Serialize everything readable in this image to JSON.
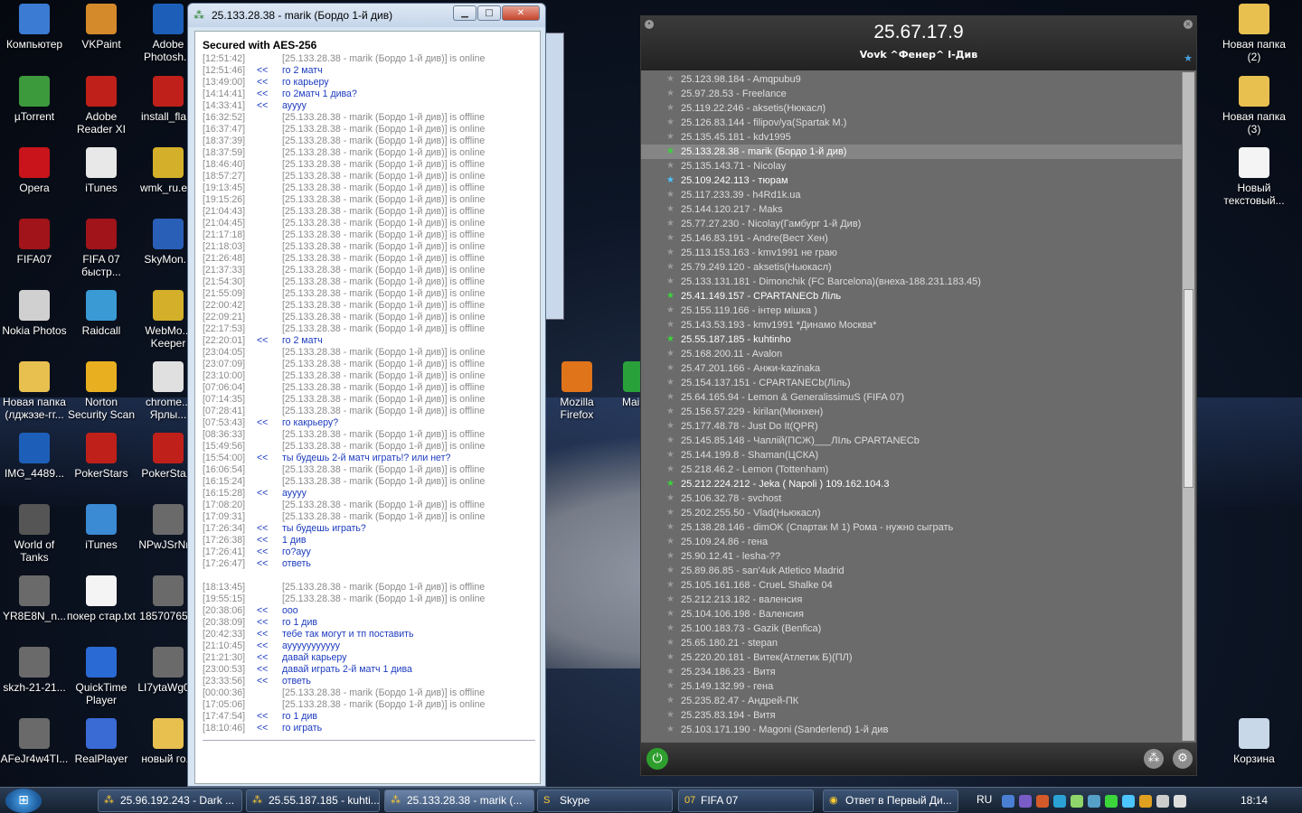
{
  "desktop_icons": [
    {
      "label": "Компьютер",
      "icon": "computer-icon"
    },
    {
      "label": "VKPaint",
      "icon": "paint-icon"
    },
    {
      "label": "Adobe Photosh...",
      "icon": "photoshop-icon"
    },
    {
      "label": "µTorrent",
      "icon": "utorrent-icon"
    },
    {
      "label": "Adobe Reader XI",
      "icon": "acrobat-icon"
    },
    {
      "label": "install_fla...",
      "icon": "flash-icon"
    },
    {
      "label": "Opera",
      "icon": "opera-icon"
    },
    {
      "label": "iTunes",
      "icon": "itunes-doc-icon"
    },
    {
      "label": "wmk_ru.e...",
      "icon": "webmoney-icon"
    },
    {
      "label": "FIFA07",
      "icon": "fifa-icon"
    },
    {
      "label": "FIFA 07 быстр...",
      "icon": "fifa-icon"
    },
    {
      "label": "SkyMon...",
      "icon": "skymon-icon"
    },
    {
      "label": "Nokia Photos",
      "icon": "nokia-icon"
    },
    {
      "label": "Raidcall",
      "icon": "raidcall-icon"
    },
    {
      "label": "WebMo... Keeper",
      "icon": "webmoney-icon"
    },
    {
      "label": "Новая папка (лджэзе-гг...",
      "icon": "folder-icon"
    },
    {
      "label": "Norton Security Scan",
      "icon": "norton-icon"
    },
    {
      "label": "chrome... Ярлы...",
      "icon": "chrome-icon"
    },
    {
      "label": "IMG_4489...",
      "icon": "psd-icon"
    },
    {
      "label": "PokerStars",
      "icon": "pokerstars-icon"
    },
    {
      "label": "PokerSta...",
      "icon": "pokerstars-icon"
    },
    {
      "label": "World of Tanks",
      "icon": "wot-icon"
    },
    {
      "label": "iTunes",
      "icon": "itunes-icon"
    },
    {
      "label": "NPwJSrNr...",
      "icon": "image-icon"
    },
    {
      "label": "YR8E8N_n...",
      "icon": "image-icon"
    },
    {
      "label": "покер стар.txt",
      "icon": "text-file-icon"
    },
    {
      "label": "18570765...",
      "icon": "image-icon"
    },
    {
      "label": "skzh-21-21...",
      "icon": "image-icon"
    },
    {
      "label": "QuickTime Player",
      "icon": "quicktime-icon"
    },
    {
      "label": "LI7ytaWg0...",
      "icon": "image-icon"
    },
    {
      "label": "AFeJr4w4TI...",
      "icon": "image-icon"
    },
    {
      "label": "RealPlayer",
      "icon": "realplayer-icon"
    },
    {
      "label": "новый го...",
      "icon": "folder-icon"
    },
    {
      "label": "Mozilla Firefox",
      "icon": "firefox-icon"
    },
    {
      "label": "Main...",
      "icon": "app-icon"
    },
    {
      "label": "Новая папка (2)",
      "icon": "folder-icon"
    },
    {
      "label": "Новая папка (3)",
      "icon": "folder-icon"
    },
    {
      "label": "Новый текстовый...",
      "icon": "text-file-icon"
    },
    {
      "label": "Корзина",
      "icon": "recycle-bin-icon"
    }
  ],
  "chat": {
    "title": "25.133.28.38 - marik (Бордо 1-й див)",
    "secured": "Secured with AES-256",
    "lines": [
      {
        "t": "[12:51:42]",
        "d": "",
        "m": "[25.133.28.38 - marik (Бордо 1-й див)] is online",
        "k": "sys"
      },
      {
        "t": "[12:51:46]",
        "d": "<<",
        "m": "го 2 матч",
        "k": "me"
      },
      {
        "t": "[13:49:00]",
        "d": "<<",
        "m": "го карьеру",
        "k": "me"
      },
      {
        "t": "[14:14:41]",
        "d": "<<",
        "m": "го 2матч 1 дива?",
        "k": "me"
      },
      {
        "t": "[14:33:41]",
        "d": "<<",
        "m": "ауууу",
        "k": "me"
      },
      {
        "t": "[16:32:52]",
        "d": "",
        "m": "[25.133.28.38 - marik (Бордо 1-й див)] is offline",
        "k": "sys"
      },
      {
        "t": "[16:37:47]",
        "d": "",
        "m": "[25.133.28.38 - marik (Бордо 1-й див)] is online",
        "k": "sys"
      },
      {
        "t": "[18:37:39]",
        "d": "",
        "m": "[25.133.28.38 - marik (Бордо 1-й див)] is offline",
        "k": "sys"
      },
      {
        "t": "[18:37:59]",
        "d": "",
        "m": "[25.133.28.38 - marik (Бордо 1-й див)] is online",
        "k": "sys"
      },
      {
        "t": "[18:46:40]",
        "d": "",
        "m": "[25.133.28.38 - marik (Бордо 1-й див)] is offline",
        "k": "sys"
      },
      {
        "t": "[18:57:27]",
        "d": "",
        "m": "[25.133.28.38 - marik (Бордо 1-й див)] is online",
        "k": "sys"
      },
      {
        "t": "[19:13:45]",
        "d": "",
        "m": "[25.133.28.38 - marik (Бордо 1-й див)] is offline",
        "k": "sys"
      },
      {
        "t": "[19:15:26]",
        "d": "",
        "m": "[25.133.28.38 - marik (Бордо 1-й див)] is online",
        "k": "sys"
      },
      {
        "t": "[21:04:43]",
        "d": "",
        "m": "[25.133.28.38 - marik (Бордо 1-й див)] is offline",
        "k": "sys"
      },
      {
        "t": "[21:04:45]",
        "d": "",
        "m": "[25.133.28.38 - marik (Бордо 1-й див)] is online",
        "k": "sys"
      },
      {
        "t": "[21:17:18]",
        "d": "",
        "m": "[25.133.28.38 - marik (Бордо 1-й див)] is offline",
        "k": "sys"
      },
      {
        "t": "[21:18:03]",
        "d": "",
        "m": "[25.133.28.38 - marik (Бордо 1-й див)] is online",
        "k": "sys"
      },
      {
        "t": "[21:26:48]",
        "d": "",
        "m": "[25.133.28.38 - marik (Бордо 1-й див)] is offline",
        "k": "sys"
      },
      {
        "t": "[21:37:33]",
        "d": "",
        "m": "[25.133.28.38 - marik (Бордо 1-й див)] is online",
        "k": "sys"
      },
      {
        "t": "[21:54:30]",
        "d": "",
        "m": "[25.133.28.38 - marik (Бордо 1-й див)] is offline",
        "k": "sys"
      },
      {
        "t": "[21:55:09]",
        "d": "",
        "m": "[25.133.28.38 - marik (Бордо 1-й див)] is online",
        "k": "sys"
      },
      {
        "t": "[22:00:42]",
        "d": "",
        "m": "[25.133.28.38 - marik (Бордо 1-й див)] is offline",
        "k": "sys"
      },
      {
        "t": "[22:09:21]",
        "d": "",
        "m": "[25.133.28.38 - marik (Бордо 1-й див)] is online",
        "k": "sys"
      },
      {
        "t": "[22:17:53]",
        "d": "",
        "m": "[25.133.28.38 - marik (Бордо 1-й див)] is offline",
        "k": "sys"
      },
      {
        "t": "[22:20:01]",
        "d": "<<",
        "m": "го 2 матч",
        "k": "me"
      },
      {
        "t": "[23:04:05]",
        "d": "",
        "m": "[25.133.28.38 - marik (Бордо 1-й див)] is online",
        "k": "sys"
      },
      {
        "t": "[23:07:09]",
        "d": "",
        "m": "[25.133.28.38 - marik (Бордо 1-й див)] is offline",
        "k": "sys"
      },
      {
        "t": "[23:10:00]",
        "d": "",
        "m": "[25.133.28.38 - marik (Бордо 1-й див)] is online",
        "k": "sys"
      },
      {
        "t": "[07:06:04]",
        "d": "",
        "m": "[25.133.28.38 - marik (Бордо 1-й див)] is offline",
        "k": "sys"
      },
      {
        "t": "[07:14:35]",
        "d": "",
        "m": "[25.133.28.38 - marik (Бордо 1-й див)] is online",
        "k": "sys"
      },
      {
        "t": "[07:28:41]",
        "d": "",
        "m": "[25.133.28.38 - marik (Бордо 1-й див)] is offline",
        "k": "sys"
      },
      {
        "t": "[07:53:43]",
        "d": "<<",
        "m": "го какрьеру?",
        "k": "me"
      },
      {
        "t": "[08:36:33]",
        "d": "",
        "m": "[25.133.28.38 - marik (Бордо 1-й див)] is offline",
        "k": "sys"
      },
      {
        "t": "[15:49:56]",
        "d": "",
        "m": "[25.133.28.38 - marik (Бордо 1-й див)] is online",
        "k": "sys"
      },
      {
        "t": "[15:54:00]",
        "d": "<<",
        "m": "ты будешь 2-й матч играть!? или нет?",
        "k": "me"
      },
      {
        "t": "[16:06:54]",
        "d": "",
        "m": "[25.133.28.38 - marik (Бордо 1-й див)] is offline",
        "k": "sys"
      },
      {
        "t": "[16:15:24]",
        "d": "",
        "m": "[25.133.28.38 - marik (Бордо 1-й див)] is online",
        "k": "sys"
      },
      {
        "t": "[16:15:28]",
        "d": "<<",
        "m": "ауууу",
        "k": "me"
      },
      {
        "t": "[17:08:20]",
        "d": "",
        "m": "[25.133.28.38 - marik (Бордо 1-й див)] is offline",
        "k": "sys"
      },
      {
        "t": "[17:09:31]",
        "d": "",
        "m": "[25.133.28.38 - marik (Бордо 1-й див)] is online",
        "k": "sys"
      },
      {
        "t": "[17:26:34]",
        "d": "<<",
        "m": "ты будешь играть?",
        "k": "me"
      },
      {
        "t": "[17:26:38]",
        "d": "<<",
        "m": "1 див",
        "k": "me"
      },
      {
        "t": "[17:26:41]",
        "d": "<<",
        "m": "го?ауу",
        "k": "me"
      },
      {
        "t": "[17:26:47]",
        "d": "<<",
        "m": "ответь",
        "k": "me"
      },
      {
        "t": "",
        "d": "",
        "m": "",
        "k": "gap"
      },
      {
        "t": "[18:13:45]",
        "d": "",
        "m": "[25.133.28.38 - marik (Бордо 1-й див)] is offline",
        "k": "sys"
      },
      {
        "t": "[19:55:15]",
        "d": "",
        "m": "[25.133.28.38 - marik (Бордо 1-й див)] is online",
        "k": "sys"
      },
      {
        "t": "[20:38:06]",
        "d": "<<",
        "m": "ооо",
        "k": "me"
      },
      {
        "t": "[20:38:09]",
        "d": "<<",
        "m": "го 1 див",
        "k": "me"
      },
      {
        "t": "[20:42:33]",
        "d": "<<",
        "m": "тебе так могут и тп поставить",
        "k": "me"
      },
      {
        "t": "[21:10:45]",
        "d": "<<",
        "m": "аууууууууууу",
        "k": "me"
      },
      {
        "t": "[21:21:30]",
        "d": "<<",
        "m": "давай карьеру",
        "k": "me"
      },
      {
        "t": "[23:00:53]",
        "d": "<<",
        "m": "давай играть 2-й матч 1 дива",
        "k": "me"
      },
      {
        "t": "[23:33:56]",
        "d": "<<",
        "m": "ответь",
        "k": "me"
      },
      {
        "t": "[00:00:36]",
        "d": "",
        "m": "[25.133.28.38 - marik (Бордо 1-й див)] is offline",
        "k": "sys"
      },
      {
        "t": "[17:05:06]",
        "d": "",
        "m": "[25.133.28.38 - marik (Бордо 1-й див)] is online",
        "k": "sys"
      },
      {
        "t": "[17:47:54]",
        "d": "<<",
        "m": "го 1 див",
        "k": "me"
      },
      {
        "t": "[18:10:46]",
        "d": "<<",
        "m": "го играть",
        "k": "me"
      }
    ]
  },
  "hamachi": {
    "ip": "25.67.17.9",
    "network": "Vovk ^Фенер^ I-Див",
    "peers": [
      {
        "label": "25.123.98.184 - Amqpubu9",
        "s": "off"
      },
      {
        "label": "25.97.28.53 - Freelance",
        "s": "off"
      },
      {
        "label": "25.119.22.246 - aksetis(Нюкасл)",
        "s": "off"
      },
      {
        "label": "25.126.83.144 - filipov/ya(Spartak M.)",
        "s": "off"
      },
      {
        "label": "25.135.45.181 - kdv1995",
        "s": "off"
      },
      {
        "label": "25.133.28.38 - marik (Бордо 1-й див)",
        "s": "on-sel"
      },
      {
        "label": "25.135.143.71 - Nicolay",
        "s": "off"
      },
      {
        "label": "25.109.242.113 - тюрам",
        "s": "idle"
      },
      {
        "label": "25.117.233.39 - h4Rd1k.ua",
        "s": "off"
      },
      {
        "label": "25.144.120.217 - Maks",
        "s": "off"
      },
      {
        "label": "25.77.27.230 - Nicolay(Гамбург 1-й Див)",
        "s": "off"
      },
      {
        "label": "25.146.83.191 - Andre(Вест Хен)",
        "s": "off"
      },
      {
        "label": "25.113.153.163 - kmv1991 не граю",
        "s": "off"
      },
      {
        "label": "25.79.249.120 - aksetis(Ньюкасл)",
        "s": "off"
      },
      {
        "label": "25.133.131.181 - Dimonchik (FC Barcelona)(внеха-188.231.183.45)",
        "s": "off"
      },
      {
        "label": "25.41.149.157 - CPARTANECb Ліль",
        "s": "on"
      },
      {
        "label": "25.155.119.166 - інтер мішка )",
        "s": "off"
      },
      {
        "label": "25.143.53.193 - kmv1991 *Динамо Москва*",
        "s": "off"
      },
      {
        "label": "25.55.187.185 - kuhtinho",
        "s": "on"
      },
      {
        "label": "25.168.200.11 - Avalon",
        "s": "off"
      },
      {
        "label": "25.47.201.166 - Анжи-kazinaka",
        "s": "off"
      },
      {
        "label": "25.154.137.151 - CPARTANECb(Ліль)",
        "s": "off"
      },
      {
        "label": "25.64.165.94 - Lemon & GeneralissimuS (FIFA 07)",
        "s": "off"
      },
      {
        "label": "25.156.57.229 - kirilan(Мюнхен)",
        "s": "off"
      },
      {
        "label": "25.177.48.78 - Just Do It(QPR)",
        "s": "off"
      },
      {
        "label": "25.145.85.148 - Чаплій(ПСЖ)___ЛІль CPARTANECb",
        "s": "off"
      },
      {
        "label": "25.144.199.8 - Shaman(ЦСКА)",
        "s": "off"
      },
      {
        "label": "25.218.46.2 - Lemon (Tottenham)",
        "s": "off"
      },
      {
        "label": "25.212.224.212 - Jeka ( Napoli ) 109.162.104.3",
        "s": "on"
      },
      {
        "label": "25.106.32.78 - svchost",
        "s": "off"
      },
      {
        "label": "25.202.255.50 - Vlad(Ньюкасл)",
        "s": "off"
      },
      {
        "label": "25.138.28.146 - dimOK (Спартак М 1) Рома - нужно сыграть",
        "s": "off"
      },
      {
        "label": "25.109.24.86 - гена",
        "s": "off"
      },
      {
        "label": "25.90.12.41 - lesha-??",
        "s": "off"
      },
      {
        "label": "25.89.86.85 - san'4uk Atletico Madrid",
        "s": "off"
      },
      {
        "label": "25.105.161.168 - CrueL Shalke 04",
        "s": "off"
      },
      {
        "label": "25.212.213.182 - валенсия",
        "s": "off"
      },
      {
        "label": "25.104.106.198 - Валенсия",
        "s": "off"
      },
      {
        "label": "25.100.183.73 - Gazik (Benfica)",
        "s": "off"
      },
      {
        "label": "25.65.180.21 - stepan",
        "s": "off"
      },
      {
        "label": "25.220.20.181 - Витек(Атлетик Б)(ПЛ)",
        "s": "off"
      },
      {
        "label": "25.234.186.23 - Витя",
        "s": "off"
      },
      {
        "label": "25.149.132.99 - гена",
        "s": "off"
      },
      {
        "label": "25.235.82.47 - Андрей-ПК",
        "s": "off"
      },
      {
        "label": "25.235.83.194 - Витя",
        "s": "off"
      },
      {
        "label": "25.103.171.190 - Magoni (Sanderlend) 1-й див",
        "s": "off"
      }
    ]
  },
  "taskbar": {
    "items": [
      {
        "label": "25.96.192.243 - Dark ..."
      },
      {
        "label": "25.55.187.185 - kuhti..."
      },
      {
        "label": "25.133.28.38 - marik (..."
      },
      {
        "label": "Skype"
      },
      {
        "label": "FIFA 07"
      },
      {
        "label": "Ответ в Первый Ди..."
      }
    ],
    "lang": "RU",
    "clock": "18:14"
  },
  "colors": {
    "online": "#3bd43b",
    "idle": "#4cc4ff",
    "outgoing": "#1c3bbf"
  }
}
